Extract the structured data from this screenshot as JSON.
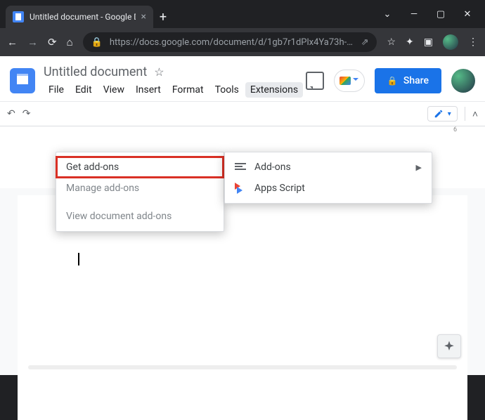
{
  "browser": {
    "tab_title": "Untitled document - Google Doc",
    "url": "https://docs.google.com/document/d/1gb7r1dPlx4Ya73h-…"
  },
  "header": {
    "doc_title": "Untitled document",
    "menus": [
      "File",
      "Edit",
      "View",
      "Insert",
      "Format",
      "Tools",
      "Extensions"
    ],
    "share_label": "Share"
  },
  "extensions_menu": {
    "items": [
      {
        "label": "Get add-ons",
        "highlighted": true
      },
      {
        "label": "Manage add-ons"
      },
      {
        "label": "View document add-ons"
      }
    ]
  },
  "submenu": {
    "items": [
      {
        "label": "Add-ons",
        "has_submenu": true,
        "icon": "addons"
      },
      {
        "label": "Apps Script",
        "icon": "apps-script"
      }
    ]
  },
  "ruler": {
    "visible_mark": "6"
  }
}
